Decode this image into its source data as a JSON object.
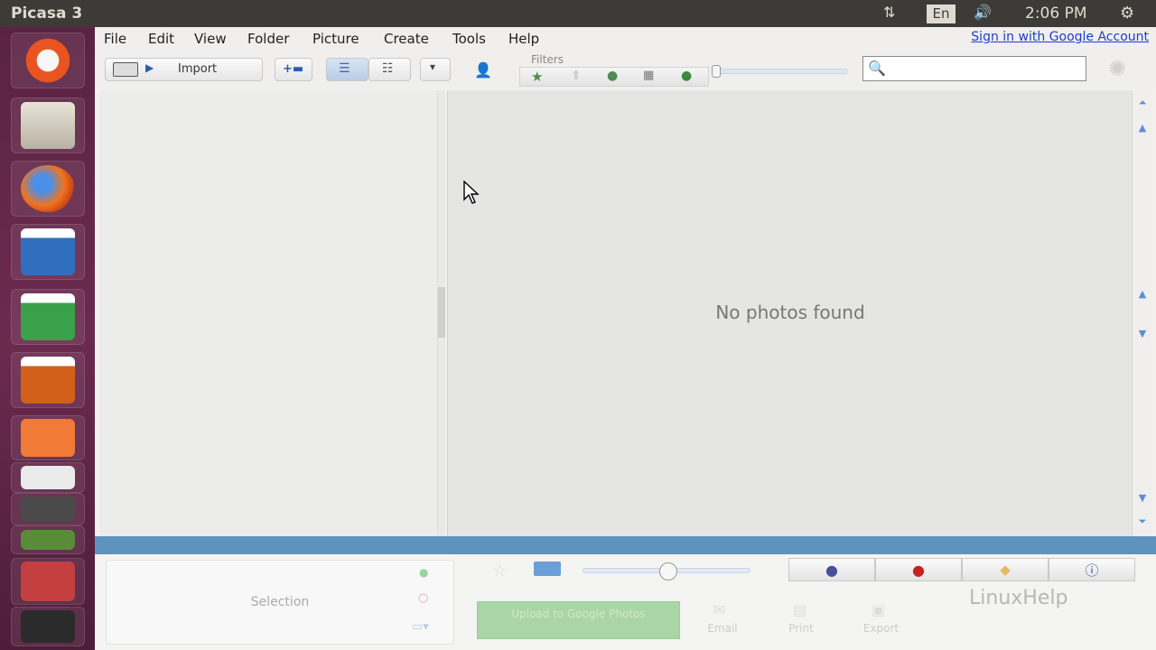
{
  "topbar": {
    "window_title": "Picasa 3",
    "language": "En",
    "time": "2:06 PM"
  },
  "menubar": {
    "items": [
      "File",
      "Edit",
      "View",
      "Folder",
      "Picture",
      "Create",
      "Tools",
      "Help"
    ],
    "signin": "Sign in with Google Account"
  },
  "toolbar": {
    "import_label": "Import",
    "filters_label": "Filters",
    "search_placeholder": ""
  },
  "main": {
    "empty_message": "No photos found"
  },
  "bottom": {
    "selection_label": "Selection",
    "upload_label": "Upload to Google Photos",
    "email_label": "Email",
    "print_label": "Print",
    "export_label": "Export"
  },
  "watermark": "LinuxHelp",
  "colors": {
    "launcher": "#5b2343",
    "accent_blue": "#5f93bf",
    "link": "#1a3fcc",
    "upload_green": "#aad6a6"
  }
}
